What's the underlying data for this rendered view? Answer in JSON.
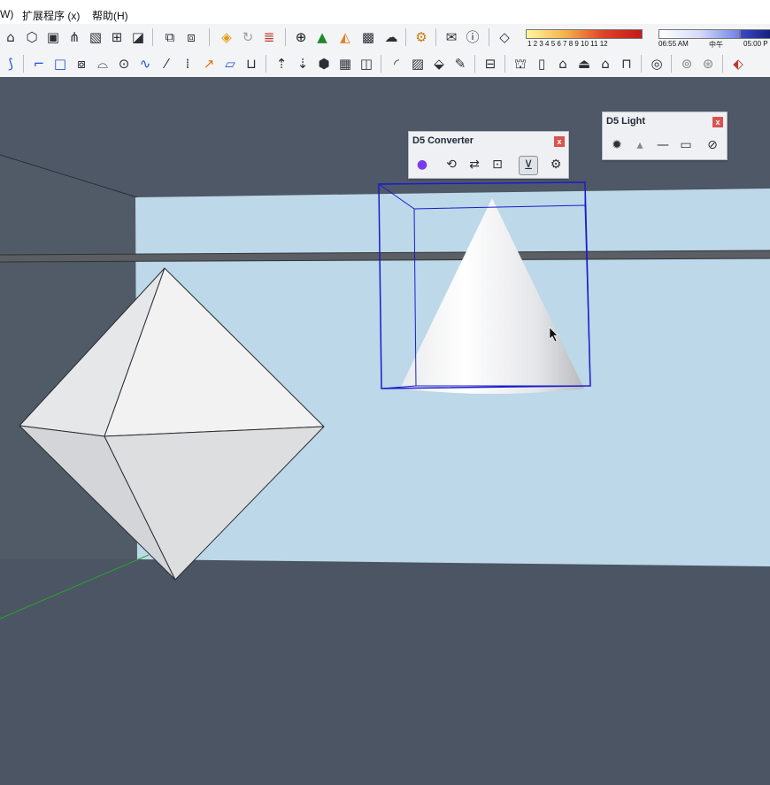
{
  "menubar": {
    "items": [
      "W)",
      "扩展程序 (x)",
      "帮助(H)"
    ]
  },
  "toolbar_row1": {
    "icons": [
      "roof-icon",
      "cube-icon",
      "box-icon",
      "plants-icon",
      "hatch-icon",
      "frame-icon",
      "edit-frame-icon",
      "layout-icon",
      "group-icon",
      "render-icon",
      "refresh-icon",
      "export-icon",
      "add-circle-icon",
      "tree-icon",
      "terrain-icon",
      "texture-icon",
      "cloud-upload-icon",
      "gears-icon",
      "mail-icon",
      "info-icon",
      "eraser-icon"
    ],
    "shadow_month_ticks": "1 2 3 4 5 6 7 8 9 10 11 12",
    "time_left": "06:55 AM",
    "time_mid": "中午",
    "time_right": "05:00 P"
  },
  "toolbar_row2": {
    "icons": [
      "sandbox-icon",
      "line-icon",
      "rectangle-icon",
      "push-icon",
      "dome-icon",
      "curve-icon",
      "wave-icon",
      "freehand-icon",
      "scatter-icon",
      "arrow-icon",
      "panel-icon",
      "basket-icon",
      "move-up-icon",
      "move-down-icon",
      "cube-solid-icon",
      "grid-icon",
      "face-icon",
      "arc-icon",
      "square-grid-icon",
      "paint-icon",
      "knife-icon",
      "window-icon",
      "house-3d-icon",
      "door-icon",
      "home-icon",
      "shed-icon",
      "house-outline-icon",
      "garage-icon",
      "sphere-icon",
      "zoom-icon",
      "magnify-icon",
      "tag-icon"
    ]
  },
  "d5_converter": {
    "title": "D5 Converter",
    "close": "x",
    "icons": [
      "d5-logo-icon",
      "sync-icon",
      "convert-icon",
      "camera-icon",
      "filter-icon",
      "settings-icon"
    ]
  },
  "d5_light": {
    "title": "D5 Light",
    "close": "x",
    "icons": [
      "point-light-icon",
      "spot-light-icon",
      "strip-light-icon",
      "area-light-icon",
      "hide-icon"
    ]
  },
  "colors": {
    "menubar_bg": "#ffffff",
    "toolbar_bg": "#f3f4f6",
    "viewport_bg": "#4b5563",
    "wall_blue": "#bcd8e9",
    "selection_blue": "#1a1ccc",
    "axis_green": "#2aa52a"
  }
}
